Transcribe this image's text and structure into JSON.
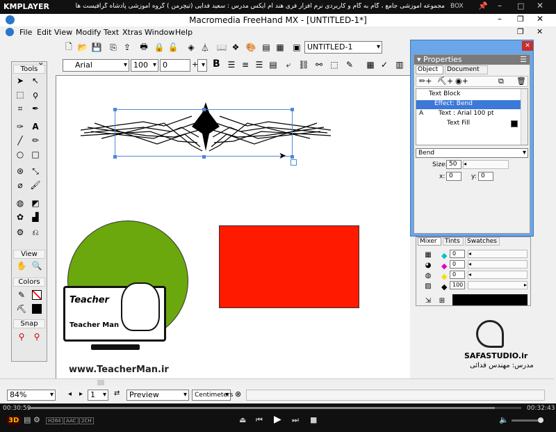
{
  "player": {
    "logo": "KMPLAYER",
    "title": "مجموعه آموزشی جامع ، گام به گام و کاربردی نرم افزار فری هند ام ایکس  مدرس : سعید فدایی (تیچرمن ) گروه آموزشی پادشاه گرافیست ها",
    "box_label": "BOX",
    "time_current": "00:30:59",
    "time_total": "00:32:43",
    "badges": [
      "H264",
      "AAC",
      "2CH"
    ],
    "mode_3d": "3D"
  },
  "app": {
    "title": "Macromedia FreeHand MX - [UNTITLED-1*]",
    "menu": [
      "File",
      "Edit",
      "View",
      "Modify",
      "Text",
      "Xtras",
      "Window",
      "Help"
    ],
    "page_select": "UNTITLED-1",
    "font_family": "Arial",
    "font_size": "100",
    "leading": "0",
    "text_style": "B",
    "zoom": "84%",
    "page_number": "1",
    "preview_mode": "Preview",
    "units": "Centimeters"
  },
  "tools_panel": {
    "title": "Tools",
    "view_label": "View",
    "colors_label": "Colors",
    "snap_label": "Snap"
  },
  "properties": {
    "title": "Properties",
    "tabs": [
      "Object",
      "Document"
    ],
    "tree": [
      {
        "label": "Text Block",
        "indent": 0,
        "selected": false,
        "prefix": ""
      },
      {
        "label": "Effect: Bend",
        "indent": 1,
        "selected": true,
        "prefix": ""
      },
      {
        "label": "Text : Arial 100 pt",
        "indent": 1,
        "selected": false,
        "prefix": "A"
      },
      {
        "label": "Text Fill",
        "indent": 2,
        "selected": false,
        "prefix": ""
      }
    ],
    "effect_select": "Bend",
    "size_label": "Size:",
    "size_value": "50",
    "x_label": "x:",
    "x_value": "0",
    "y_label": "y:",
    "y_value": "0"
  },
  "mixer": {
    "tabs": [
      "Mixer",
      "Tints",
      "Swatches"
    ],
    "channels": [
      {
        "color": "#00c0d0",
        "value": "0"
      },
      {
        "color": "#e000c0",
        "value": "0"
      },
      {
        "color": "#f0e000",
        "value": "0"
      },
      {
        "color": "#000000",
        "value": "100"
      }
    ],
    "swatch_color": "#000000"
  },
  "watermark": {
    "teacher_site": "www.TeacherMan.ir",
    "teacher_name": "Teacher Man",
    "teacher_tag": "Teacher",
    "safa_site": "SAFASTUDIO.ir",
    "safa_caption": "مدرس: مهندس فدائی"
  },
  "canvas": {
    "circle_color": "#6aa80e",
    "rect_color": "#ff1a00"
  }
}
